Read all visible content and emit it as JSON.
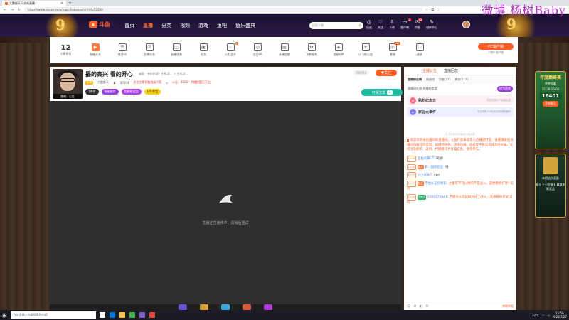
{
  "browser": {
    "tab_title": "大鹏聊天于艺的直播",
    "url": "https://www.douyu.com/topic/tiebeanchu?rid=52240",
    "watermark": "微博 杨树Baby"
  },
  "site": {
    "logo": "斗鱼",
    "nav": [
      "首页",
      "直播",
      "分类",
      "视频",
      "游戏",
      "鱼吧",
      "鱼乐盛典"
    ],
    "search_placeholder": "搜索主播",
    "header_icons": [
      {
        "label": "历史",
        "glyph": "◷",
        "badge": ""
      },
      {
        "label": "关注",
        "glyph": "♡",
        "badge": ""
      },
      {
        "label": "下载",
        "glyph": "⇩",
        "badge": ""
      },
      {
        "label": "客户端",
        "glyph": "▭",
        "badge": "2"
      },
      {
        "label": "消息",
        "glyph": "✉",
        "badge": "99"
      },
      {
        "label": "创作中心",
        "glyph": "✎",
        "badge": ""
      }
    ]
  },
  "tasks": {
    "level": "12",
    "level_label": "主播排行",
    "items": [
      {
        "label": "直播开关",
        "glyph": "▶",
        "badge": "",
        "highlight": true
      },
      {
        "label": "推荐码",
        "glyph": "☰",
        "badge": ""
      },
      {
        "label": "主播任务",
        "glyph": "☑",
        "badge": ""
      },
      {
        "label": "直播任务",
        "glyph": "◫",
        "badge": ""
      },
      {
        "label": "礼包",
        "glyph": "▣",
        "badge": ""
      },
      {
        "label": "火力全开",
        "glyph": "♨",
        "badge": "1"
      },
      {
        "label": "全民ER",
        "glyph": "◎",
        "badge": ""
      },
      {
        "label": "开播提醒",
        "glyph": "▤",
        "badge": ""
      },
      {
        "label": "飞鹤福利",
        "glyph": "✿",
        "badge": ""
      },
      {
        "label": "超级VIP",
        "glyph": "◈",
        "badge": ""
      },
      {
        "label": "小飞船公益",
        "glyph": "✈",
        "badge": ""
      },
      {
        "label": "客服",
        "glyph": "☏",
        "badge": "new"
      },
      {
        "label": "更多",
        "glyph": "⋯",
        "badge": ""
      }
    ],
    "pc_client": "PC客户端",
    "pc_client_sub": "下载PC客户端"
  },
  "stream": {
    "title": "播的高兴 看的开心",
    "category": "桌面 · 单机热游 · 主机游... > 主机游...",
    "avatar_caption": "鱼吧 · 公告",
    "anchor_tag": "主播",
    "anchor_name": "大鹏聊天",
    "fans": "30504",
    "report": "关注主播领取超级大奖",
    "notice": "公告：8525 · 开播提醒已开启",
    "badges": [
      "1周榜",
      "福星推荐",
      "超级粉丝团",
      "1/0 财富"
    ],
    "hot": "799793",
    "follow": "关注",
    "gift_count_label": "可领次数",
    "gift_count": "1",
    "share": "分享",
    "report_link": "举报反馈",
    "offline_text": "主播正在连线中，请稍后重试"
  },
  "panel": {
    "tabs": [
      "主播公告",
      "直播回放"
    ],
    "rank_tabs": [
      "直播粉丝榜",
      "周星榜",
      "贡献(37)",
      "贵宾(112)"
    ],
    "rank_row_text": "直播间礼物 开播前看看",
    "rank_btn": "成为贵宾",
    "events": [
      {
        "title": "贴粉纪念日",
        "sub": "今日共有0个贴粉纪念",
        "icon": "★",
        "style": "pink"
      },
      {
        "title": "家园大事件",
        "sub": "今日共有1个粉丝在线领取福利",
        "icon": "⌂",
        "style": "blue"
      }
    ],
    "chat_divider": "以下为您在本房间已读消息",
    "sys_notice": "欢迎来到本直播间的直播间。斗鱼严禁未成年人直播或打赏，请谨慎辨别直播间内的任何信息。如遇到低俗、违法违规、侵权等不良信息请及时举报。任何涉及刷单、返利、代理等均为诈骗信息，请勿参与。",
    "messages": [
      {
        "level": "Lv.18",
        "fan": "",
        "name": "蓝色风暴FZ",
        "text": "驾驶!"
      },
      {
        "level": "Lv.15",
        "fan": "粉丝",
        "name": "非...国际新星",
        "text": "唯"
      },
      {
        "level": "Lv.12",
        "fan": "",
        "name": "小小米米7",
        "text": "vpn"
      },
      {
        "level": "Lv.17",
        "fan": "粉丝",
        "name": "不怕从这份精彩",
        "text": "主播可不可以拼的不是战斗，是想看他打架! 说的"
      },
      {
        "level": "Lv.15",
        "fan": "小鱼丸",
        "name": "1505570841",
        "text": "不说你斗的就知你开了战斗，还想看他打架 说的"
      }
    ],
    "report": "弹幕举报"
  },
  "promo": {
    "title": "年度巅峰赛",
    "sub": "争夺宝藏",
    "time": "15:30-16:00",
    "num": "16401",
    "btn": "立即参与",
    "card_title": "本期抽卡奖励",
    "card_sub": "参与下一轮抽卡 赢取丰厚奖品"
  },
  "taskbar": {
    "search": "在这里输入你要搜索的内容",
    "temp": "32°C",
    "time": "15:50",
    "date": "2022/7/27"
  }
}
